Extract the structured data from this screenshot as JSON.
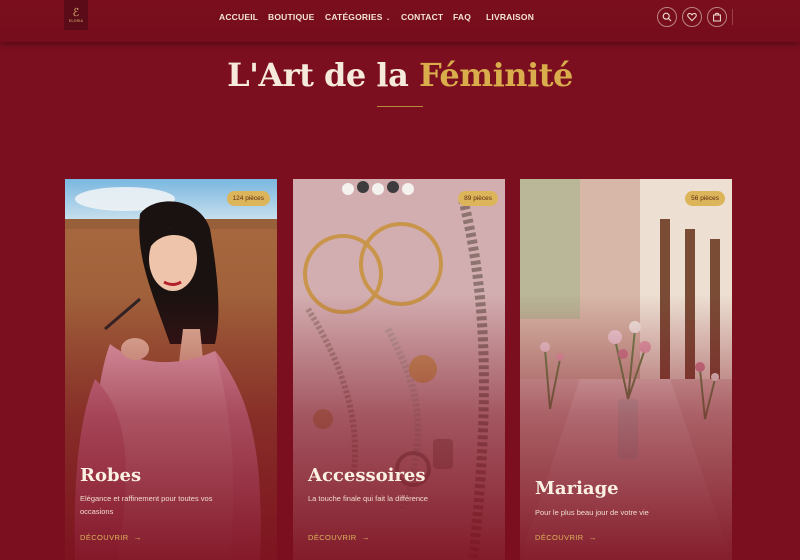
{
  "brand": {
    "logo_mark": "ℰ",
    "logo_text": "ELORIA"
  },
  "nav": {
    "items": [
      {
        "label": "ACCUEIL"
      },
      {
        "label": "BOUTIQUE"
      },
      {
        "label": "CATÉGORIES"
      },
      {
        "label": "CONTACT"
      },
      {
        "label": "FAQ"
      },
      {
        "label": "LIVRAISON"
      }
    ],
    "icons": [
      "search-icon",
      "heart-icon",
      "shopping-bag-icon"
    ]
  },
  "hero": {
    "title_main": "L'Art de la ",
    "title_accent": "Féminité"
  },
  "cards": [
    {
      "badge": "124 pièces",
      "title": "Robes",
      "description": "Elégance et raffinement pour toutes vos occasions",
      "link": "DÉCOUVRIR",
      "link_icon": "arrow-right-icon"
    },
    {
      "badge": "89 pièces",
      "title": "Accessoires",
      "description": "La touche finale qui fait la différence",
      "link": "DÉCOUVRIR",
      "link_icon": "arrow-right-icon"
    },
    {
      "badge": "56 pièces",
      "title": "Mariage",
      "description": "Pour le plus beau jour de votre vie",
      "link": "DÉCOUVRIR",
      "link_icon": "arrow-right-icon"
    }
  ],
  "colors": {
    "background": "#7c0f1f",
    "accent_gold": "#d9ad4b",
    "text_light": "#f6eadc"
  }
}
